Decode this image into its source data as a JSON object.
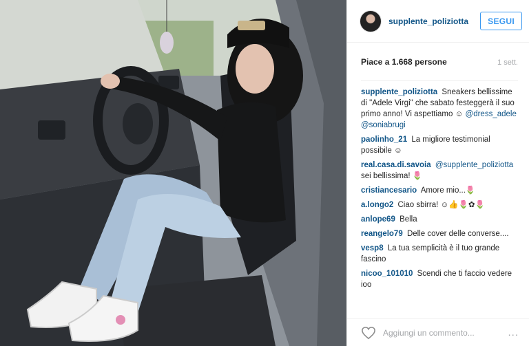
{
  "post": {
    "username": "supplente_poliziotta",
    "follow_label": "SEGUI",
    "likes": "Piace a 1.668 persone",
    "time": "1 sett.",
    "caption": {
      "author": "supplente_poliziotta",
      "text": "Sneakers bellissime di \"Adele Virgi\" che sabato festeggerà il suo primo anno! Vi aspettiamo ☺",
      "mention1": "@dress_adele",
      "mention2": "@soniabrugi"
    },
    "comments": [
      {
        "author": "paolinho_21",
        "text": "La migliore testimonial possibile ☺"
      },
      {
        "author": "real.casa.di.savoia",
        "mention": "@supplente_poliziotta",
        "text": "sei bellissima! 🌷"
      },
      {
        "author": "cristiancesario",
        "text": "Amore mio...🌷"
      },
      {
        "author": "a.longo2",
        "text": "Ciao sbirra! ☺👍🌷✿🌷"
      },
      {
        "author": "anlope69",
        "text": "Bella"
      },
      {
        "author": "reangelo79",
        "text": "Delle cover delle converse...."
      },
      {
        "author": "vesp8",
        "text": "La tua semplicità è il tuo grande fascino"
      },
      {
        "author": "nicoo_101010",
        "text": "Scendi che ti faccio vedere ioo"
      }
    ],
    "comment_placeholder": "Aggiungi un commento...",
    "more_label": "..."
  },
  "icons": {
    "like": "heart-outline-icon",
    "more": "ellipsis-icon"
  },
  "colors": {
    "link": "#125688",
    "follow": "#3897f0",
    "muted": "#a5a7aa"
  }
}
